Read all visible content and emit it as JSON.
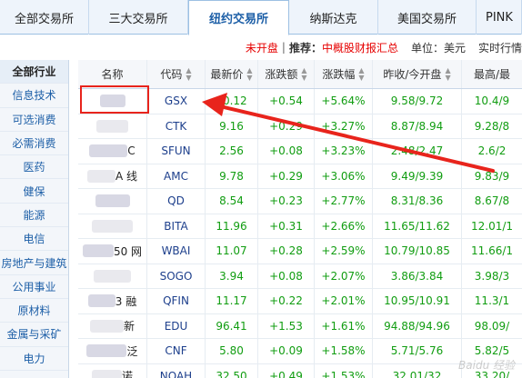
{
  "tabs": [
    {
      "label": "全部交易所",
      "active": false
    },
    {
      "label": "三大交易所",
      "active": false
    },
    {
      "label": "纽约交易所",
      "active": true
    },
    {
      "label": "纳斯达克",
      "active": false
    },
    {
      "label": "美国交易所",
      "active": false
    },
    {
      "label": "PINK",
      "active": false
    }
  ],
  "infobar": {
    "status": "未开盘",
    "recommend_label": "推荐：",
    "recommend_link": "中概股财报汇总",
    "unit": "单位：美元",
    "realtime": "实时行情"
  },
  "sidebar": {
    "header": "全部行业",
    "items": [
      "信息技术",
      "可选消费",
      "必需消费",
      "医药",
      "健保",
      "能源",
      "电信",
      "房地产与建筑",
      "公用事业",
      "原材料",
      "金属与采矿",
      "电力"
    ]
  },
  "table": {
    "columns": {
      "name": "名称",
      "code": "代码",
      "price": "最新价",
      "change": "涨跌额",
      "pct": "涨跌幅",
      "prev_open": "昨收/今开盘",
      "high_low": "最高/最"
    },
    "rows": [
      {
        "name_fragment": "",
        "code": "GSX",
        "price": "10.12",
        "change": "+0.54",
        "pct": "+5.64%",
        "prev_open": "9.58/9.72",
        "high_low": "10.4/9"
      },
      {
        "name_fragment": "",
        "code": "CTK",
        "price": "9.16",
        "change": "+0.29",
        "pct": "+3.27%",
        "prev_open": "8.87/8.94",
        "high_low": "9.28/8"
      },
      {
        "name_fragment": "C",
        "code": "SFUN",
        "price": "2.56",
        "change": "+0.08",
        "pct": "+3.23%",
        "prev_open": "2.48/2.47",
        "high_low": "2.6/2"
      },
      {
        "name_fragment": "A 线",
        "code": "AMC",
        "price": "9.78",
        "change": "+0.29",
        "pct": "+3.06%",
        "prev_open": "9.49/9.39",
        "high_low": "9.83/9"
      },
      {
        "name_fragment": "",
        "code": "QD",
        "price": "8.54",
        "change": "+0.23",
        "pct": "+2.77%",
        "prev_open": "8.31/8.36",
        "high_low": "8.67/8"
      },
      {
        "name_fragment": "",
        "code": "BITA",
        "price": "11.96",
        "change": "+0.31",
        "pct": "+2.66%",
        "prev_open": "11.65/11.62",
        "high_low": "12.01/1"
      },
      {
        "name_fragment": "50 网",
        "code": "WBAI",
        "price": "11.07",
        "change": "+0.28",
        "pct": "+2.59%",
        "prev_open": "10.79/10.85",
        "high_low": "11.66/1"
      },
      {
        "name_fragment": "",
        "code": "SOGO",
        "price": "3.94",
        "change": "+0.08",
        "pct": "+2.07%",
        "prev_open": "3.86/3.84",
        "high_low": "3.98/3"
      },
      {
        "name_fragment": "3 融",
        "code": "QFIN",
        "price": "11.17",
        "change": "+0.22",
        "pct": "+2.01%",
        "prev_open": "10.95/10.91",
        "high_low": "11.3/1"
      },
      {
        "name_fragment": "新",
        "code": "EDU",
        "price": "96.41",
        "change": "+1.53",
        "pct": "+1.61%",
        "prev_open": "94.88/94.96",
        "high_low": "98.09/"
      },
      {
        "name_fragment": "泛",
        "code": "CNF",
        "price": "5.80",
        "change": "+0.09",
        "pct": "+1.58%",
        "prev_open": "5.71/5.76",
        "high_low": "5.82/5"
      },
      {
        "name_fragment": "诺",
        "code": "NOAH",
        "price": "32.50",
        "change": "+0.49",
        "pct": "+1.53%",
        "prev_open": "32.01/32",
        "high_low": "33.20/"
      }
    ]
  },
  "colors": {
    "up": "#119d11",
    "link": "#1d5fa7",
    "alert": "#e60000",
    "annotation": "#e8241c"
  }
}
